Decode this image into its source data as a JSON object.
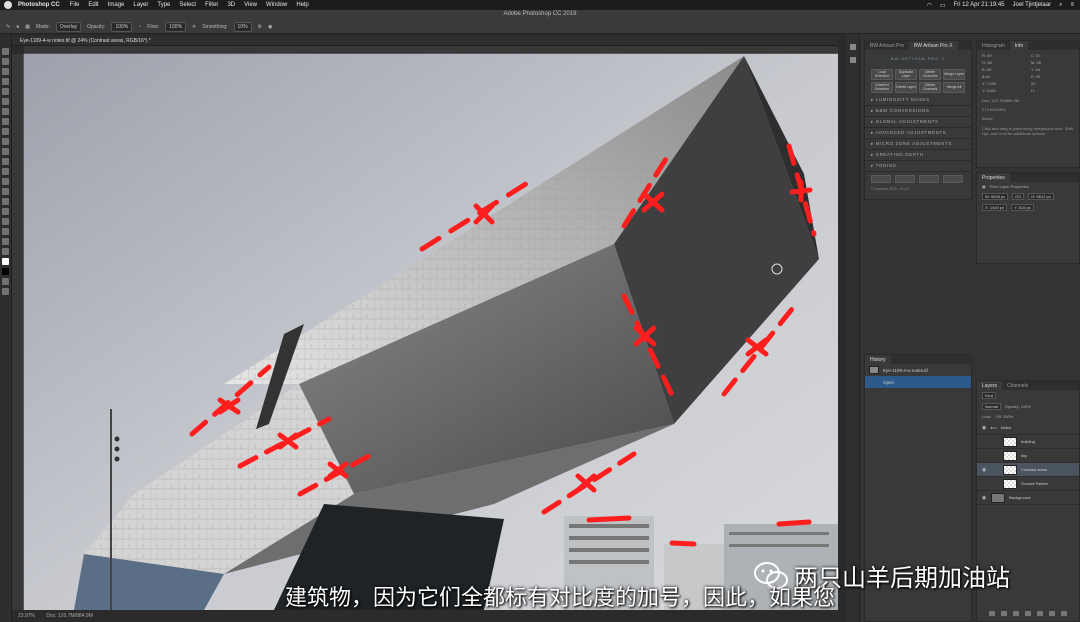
{
  "menubar": {
    "app": "Photoshop CC",
    "items": [
      "File",
      "Edit",
      "Image",
      "Layer",
      "Type",
      "Select",
      "Filter",
      "3D",
      "View",
      "Window",
      "Help"
    ],
    "datetime": "Fri 12 Apr  21:19:45",
    "user": "Joel Tjintjelaar"
  },
  "options": {
    "title": "Adobe Photoshop CC 2019",
    "mode_label": "Mode:",
    "mode_value": "Overlay",
    "opacity_label": "Opacity:",
    "opacity_value": "100%",
    "flow_label": "Flow:",
    "flow_value": "100%",
    "smoothing_label": "Smoothing:",
    "smoothing_value": "10%"
  },
  "document": {
    "tab_title": "Eye-1109-4-w notes.tif @ 24% (Contrast areas, RGB/16*) *",
    "zoom": "23.97%",
    "doc_size": "Doc: 120.7M/884.9M"
  },
  "artisan": {
    "tabs": [
      "BW Artisan Pro",
      "BW Artisan Pro X"
    ],
    "logo": "BW ARTISAN PRO X",
    "buttons": [
      "Load Selection",
      "Duplicate Layer",
      "Delete Channels",
      "Merge Layer",
      "Deselect Selection",
      "Delete Layer",
      "Delete Channels",
      "Merge All"
    ],
    "sections": [
      "LUMINOSITY MASKS",
      "B&W CONVERSIONS",
      "GLOBAL ADJUSTMENTS",
      "ADVANCED ADJUSTMENTS",
      "MICRO ZONE ADJUSTMENTS",
      "CREATING DEPTH",
      "TONING"
    ],
    "version": "© bwvision 2019 - v1.0.0"
  },
  "history": {
    "title": "History",
    "snapshot": "Eye-1109-4-w notes.tif",
    "items": [
      "Open"
    ]
  },
  "info": {
    "tabs": [
      "Histogram",
      "Info"
    ],
    "values": [
      "R: 69",
      "C: 67",
      "G: 68",
      "M: 56",
      "B: 69",
      "Y: 54",
      "8-bit",
      "K: 29",
      "X: 7156",
      "W:",
      "Y: 2165",
      "H:"
    ],
    "doc_line": "Doc: 120.7M/884.9M",
    "size_line": "273.6/2265%",
    "brush_line": "Brush",
    "hint": "Click and drag to paint using foreground color. Shift, Opt, and Cmd for additional options."
  },
  "properties": {
    "title": "Properties",
    "subtitle": "Pixel Layer Properties",
    "w": "W: 9008 px",
    "h": "H: 5612 px",
    "go": "GO",
    "x": "X: 1440 px",
    "y": "Y: 615 px"
  },
  "layers": {
    "tabs": [
      "Layers",
      "Channels"
    ],
    "kind": "Kind",
    "blend": "Normal",
    "opacity": "Opacity: 100%",
    "lock": "Lock:",
    "fill": "Fill: 100%",
    "group": "Notes",
    "items": [
      "building",
      "sky",
      "Contrast areas",
      "Ground Pattern"
    ],
    "background": "Background"
  },
  "subtitle": "建筑物，因为它们全都标有对比度的加号，因此，如果您",
  "watermark": "两只山羊后期加油站"
}
